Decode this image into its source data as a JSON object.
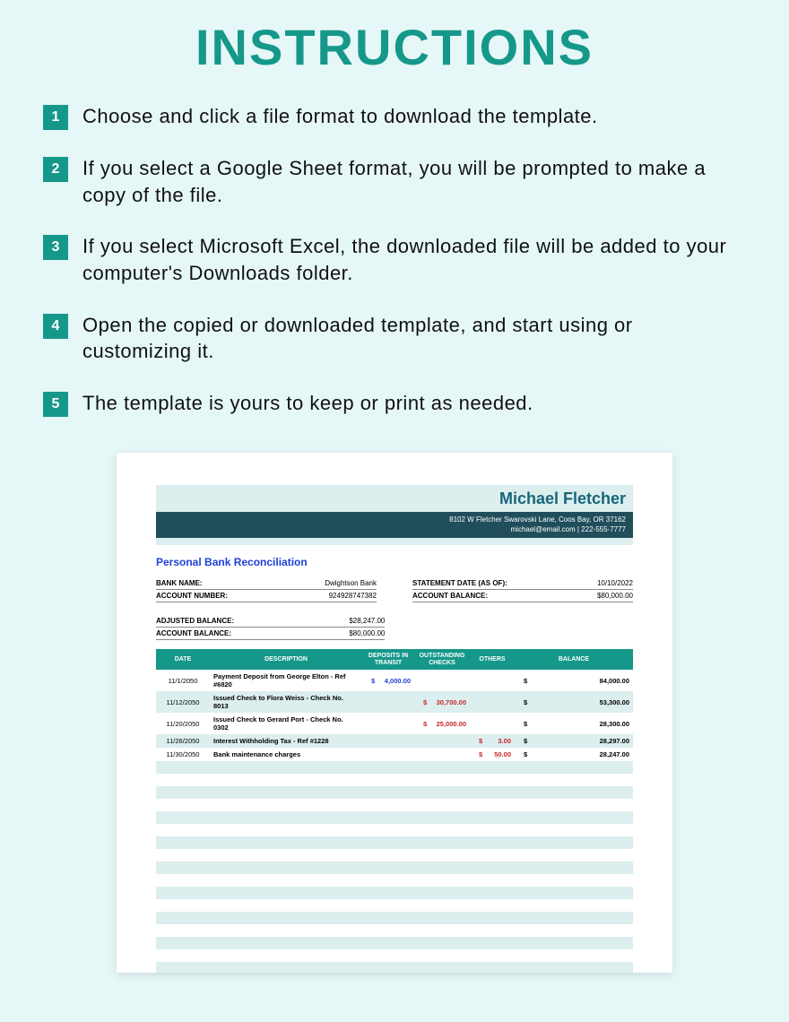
{
  "title": "INSTRUCTIONS",
  "instructions": [
    "Choose and click a file format to download the template.",
    "If you select a Google Sheet format, you will be prompted to make a copy of the file.",
    "If you select Microsoft Excel, the downloaded file will be added to your computer's Downloads folder.",
    "Open the copied or downloaded template, and start using or customizing it.",
    "The template is yours to keep or print as needed."
  ],
  "preview": {
    "name": "Michael Fletcher",
    "address": "8102 W Fletcher Swarovski Lane, Coos Bay, OR 37162",
    "contact": "michael@email.com | 222-555-7777",
    "section_title": "Personal Bank Reconciliation",
    "left_fields": {
      "bank_name_label": "BANK NAME:",
      "bank_name": "Dwightson Bank",
      "acct_num_label": "ACCOUNT NUMBER:",
      "acct_num": "924928747382"
    },
    "right_fields": {
      "stmt_date_label": "STATEMENT DATE (AS OF):",
      "stmt_date": "10/10/2022",
      "acct_bal_label": "ACCOUNT BALANCE:",
      "acct_bal": "$80,000.00"
    },
    "summary": {
      "adj_bal_label": "ADJUSTED BALANCE:",
      "adj_bal": "$28,247.00",
      "acct_bal_label": "ACCOUNT BALANCE:",
      "acct_bal": "$80,000.00"
    },
    "columns": {
      "date": "DATE",
      "desc": "DESCRIPTION",
      "deposits": "DEPOSITS IN TRANSIT",
      "outstanding": "OUTSTANDING CHECKS",
      "others": "OTHERS",
      "balance": "BALANCE"
    },
    "rows": [
      {
        "date": "11/1/2050",
        "desc": "Payment Deposit from George Elton - Ref #6820",
        "deposits": "4,000.00",
        "outstanding": "",
        "others": "",
        "balance": "84,000.00"
      },
      {
        "date": "11/12/2050",
        "desc": "Issued Check to Flora Weiss - Check No. 8013",
        "deposits": "",
        "outstanding": "30,700.00",
        "others": "",
        "balance": "53,300.00"
      },
      {
        "date": "11/20/2050",
        "desc": "Issued Check to Gerard Port - Check No. 0302",
        "deposits": "",
        "outstanding": "25,000.00",
        "others": "",
        "balance": "28,300.00"
      },
      {
        "date": "11/26/2050",
        "desc": "Interest Withholding Tax - Ref #1228",
        "deposits": "",
        "outstanding": "",
        "others": "3.00",
        "balance": "28,297.00"
      },
      {
        "date": "11/30/2050",
        "desc": "Bank maintenance charges",
        "deposits": "",
        "outstanding": "",
        "others": "50.00",
        "balance": "28,247.00"
      }
    ]
  }
}
